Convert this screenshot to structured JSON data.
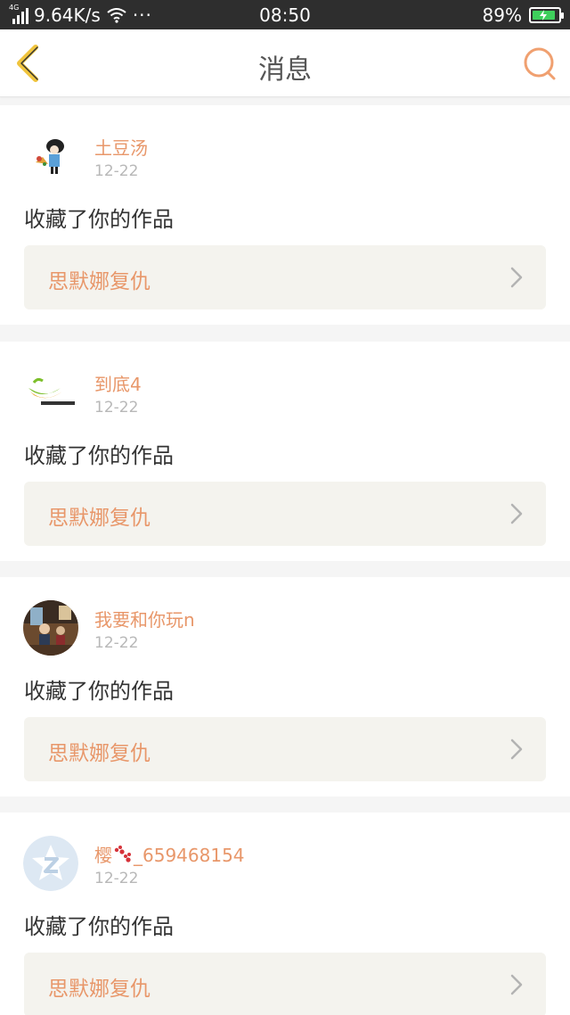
{
  "status_bar": {
    "network_type": "4G",
    "speed": "9.64K/s",
    "more": "···",
    "time": "08:50",
    "battery": "89%",
    "battery_level": 0.89
  },
  "header": {
    "title": "消息",
    "back_icon": "chevron-left-icon",
    "search_icon": "search-icon"
  },
  "colors": {
    "accent": "#e8976a",
    "back_icon": "#f0c43c",
    "search_icon": "#f0a070",
    "work_link_bg": "#f4f3ee"
  },
  "notifications": [
    {
      "username": "土豆汤",
      "date": "12-22",
      "action": "收藏了你的作品",
      "work_title": "思默娜复仇"
    },
    {
      "username": "到底4",
      "date": "12-22",
      "action": "收藏了你的作品",
      "work_title": "思默娜复仇"
    },
    {
      "username": "我要和你玩n",
      "date": "12-22",
      "action": "收藏了你的作品",
      "work_title": "思默娜复仇"
    },
    {
      "username": "樱",
      "username_suffix": "_659468154",
      "date": "12-22",
      "action": "收藏了你的作品",
      "work_title": "思默娜复仇"
    }
  ]
}
